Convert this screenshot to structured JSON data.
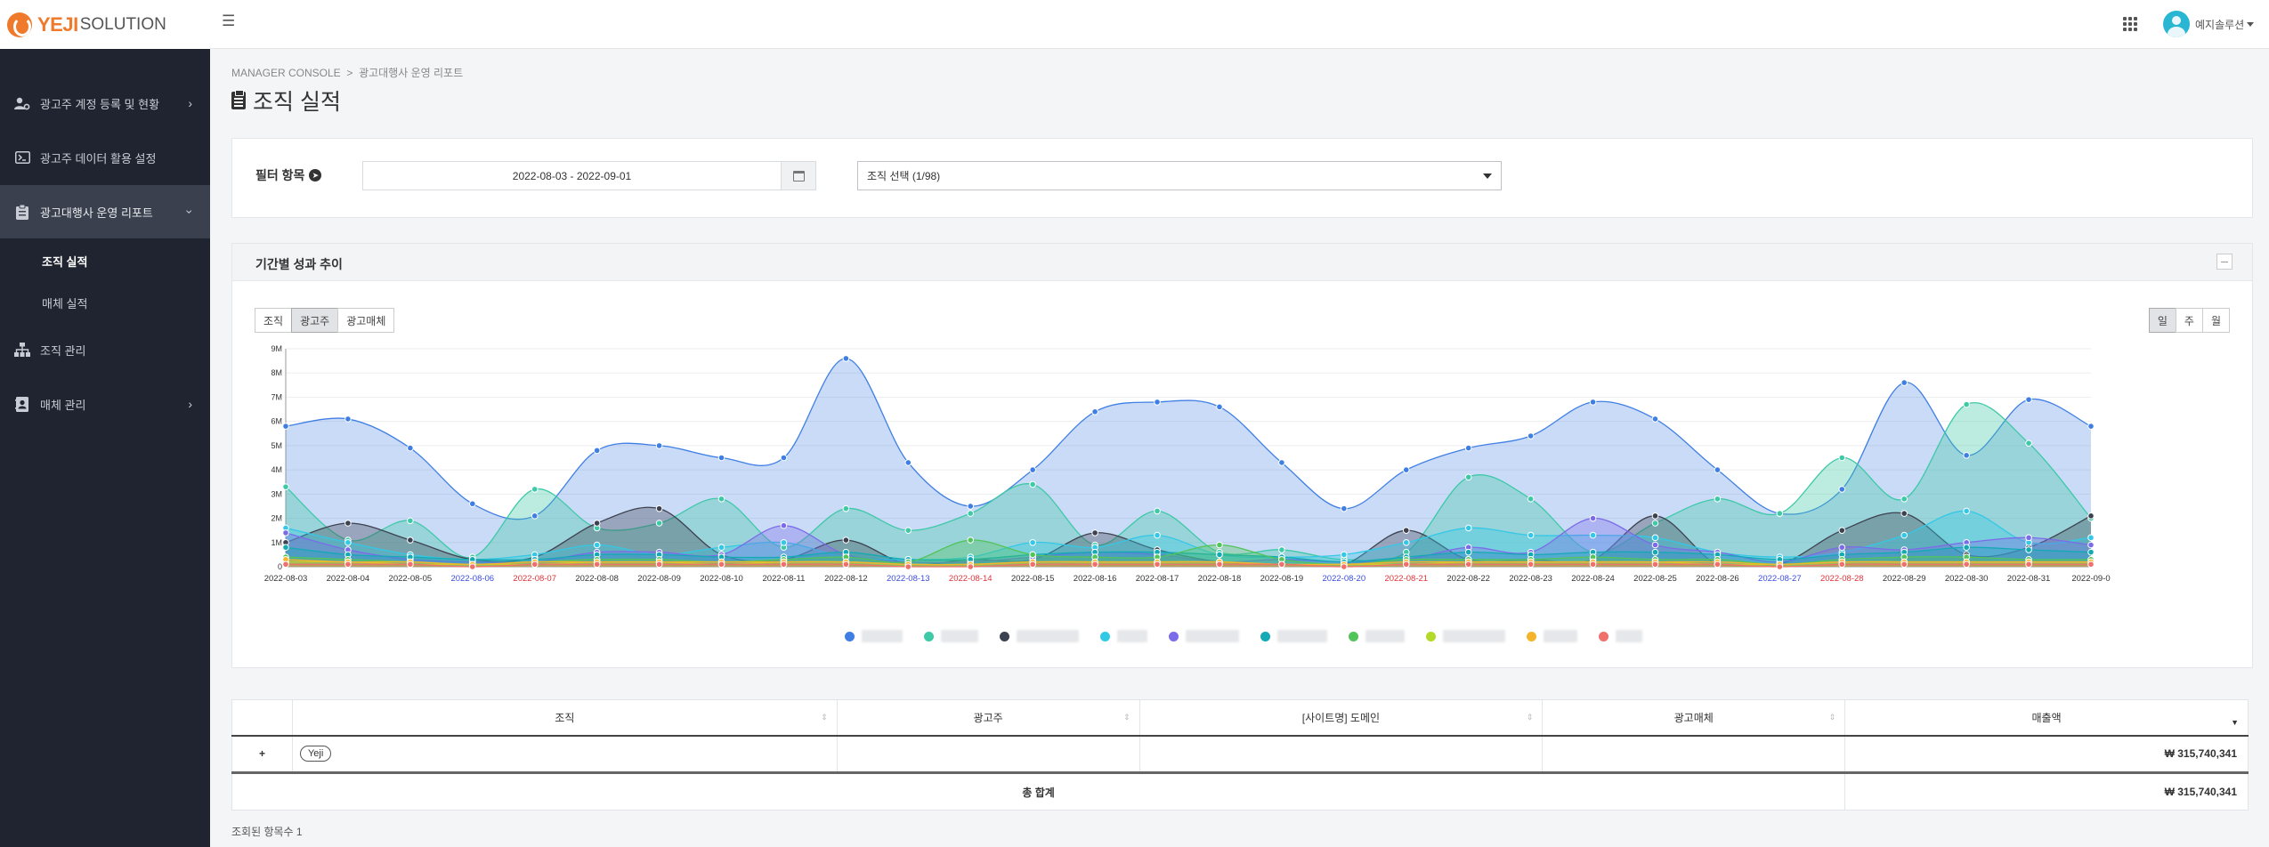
{
  "brand": {
    "name_bold": "YEJI",
    "name_light": "SOLUTION",
    "color": "#f07a2c"
  },
  "header": {
    "user_name": "예지솔루션"
  },
  "sidebar": {
    "items": [
      {
        "label": "광고주 계정 등록 및 현황",
        "icon": "user-gear-icon"
      },
      {
        "label": "광고주 데이터 활용 설정",
        "icon": "terminal-icon"
      },
      {
        "label": "광고대행사 운영 리포트",
        "icon": "clipboard-icon"
      },
      {
        "label": "조직 관리",
        "icon": "org-chart-icon"
      },
      {
        "label": "매체 관리",
        "icon": "address-book-icon"
      }
    ],
    "subitems": [
      {
        "label": "조직 실적"
      },
      {
        "label": "매체 실적"
      }
    ]
  },
  "breadcrumb": {
    "root": "MANAGER CONSOLE",
    "sep": ">",
    "current": "광고대행사 운영 리포트"
  },
  "page": {
    "title": "조직 실적"
  },
  "filter": {
    "label": "필터 항목",
    "date_range": "2022-08-03 - 2022-09-01",
    "org_select": "조직 선택 (1/98)"
  },
  "trend": {
    "title": "기간별 성과 추이",
    "group_buttons": [
      "조직",
      "광고주",
      "광고매체"
    ],
    "group_selected": "광고주",
    "period_buttons": [
      "일",
      "주",
      "월"
    ],
    "period_selected": "일"
  },
  "chart_data": {
    "type": "area",
    "x": [
      "2022-08-03",
      "2022-08-04",
      "2022-08-05",
      "2022-08-06",
      "2022-08-07",
      "2022-08-08",
      "2022-08-09",
      "2022-08-10",
      "2022-08-11",
      "2022-08-12",
      "2022-08-13",
      "2022-08-14",
      "2022-08-15",
      "2022-08-16",
      "2022-08-17",
      "2022-08-18",
      "2022-08-19",
      "2022-08-20",
      "2022-08-21",
      "2022-08-22",
      "2022-08-23",
      "2022-08-24",
      "2022-08-25",
      "2022-08-26",
      "2022-08-27",
      "2022-08-28",
      "2022-08-29",
      "2022-08-30",
      "2022-08-31",
      "2022-09-0"
    ],
    "x_label_colors": {
      "blue": [
        "2022-08-06",
        "2022-08-13",
        "2022-08-20",
        "2022-08-27"
      ],
      "red": [
        "2022-08-07",
        "2022-08-14",
        "2022-08-21",
        "2022-08-28"
      ]
    },
    "y_ticks": [
      "0",
      "1M",
      "2M",
      "3M",
      "4M",
      "5M",
      "6M",
      "7M",
      "8M",
      "9M"
    ],
    "ylim": [
      0,
      9000000
    ],
    "grid": true,
    "legend_position": "bottom",
    "series": [
      {
        "color": "#3f7fe4",
        "values": [
          5.8,
          6.1,
          4.9,
          2.6,
          2.1,
          4.8,
          5.0,
          4.5,
          4.5,
          8.6,
          4.3,
          2.5,
          4.0,
          6.4,
          6.8,
          6.6,
          4.3,
          2.4,
          4.0,
          4.9,
          5.4,
          6.8,
          6.1,
          4.0,
          2.2,
          3.2,
          7.6,
          4.6,
          6.9,
          5.8
        ]
      },
      {
        "color": "#3ec9a7",
        "values": [
          3.3,
          1.1,
          1.9,
          0.4,
          3.2,
          1.6,
          1.8,
          2.8,
          0.8,
          2.4,
          1.5,
          2.2,
          3.4,
          0.9,
          2.3,
          0.6,
          0.7,
          0.3,
          0.6,
          3.7,
          2.8,
          0.6,
          1.8,
          2.8,
          2.2,
          4.5,
          2.8,
          6.7,
          5.1,
          2.0
        ]
      },
      {
        "color": "#3d4250",
        "values": [
          1.0,
          1.8,
          1.1,
          0.3,
          0.4,
          1.8,
          2.4,
          0.5,
          0.3,
          1.1,
          0.1,
          0.3,
          0.3,
          1.4,
          0.7,
          0.2,
          0.1,
          0.1,
          1.5,
          0.3,
          0.3,
          0.3,
          2.1,
          0.1,
          0.1,
          1.5,
          2.2,
          0.5,
          0.8,
          2.1
        ]
      },
      {
        "color": "#33c8e6",
        "values": [
          1.6,
          1.0,
          0.5,
          0.3,
          0.5,
          0.9,
          0.5,
          0.8,
          1.0,
          0.4,
          0.3,
          0.4,
          1.0,
          0.8,
          1.3,
          0.5,
          0.4,
          0.5,
          1.0,
          1.6,
          1.3,
          1.3,
          1.2,
          0.6,
          0.4,
          0.6,
          1.3,
          2.3,
          1.0,
          1.2
        ]
      },
      {
        "color": "#7b6be8",
        "values": [
          1.4,
          0.7,
          0.3,
          0.2,
          0.2,
          0.6,
          0.6,
          0.5,
          1.7,
          0.5,
          0.2,
          0.2,
          0.4,
          0.6,
          0.5,
          0.2,
          0.3,
          0.2,
          0.3,
          0.8,
          0.6,
          2.0,
          0.9,
          0.6,
          0.2,
          0.8,
          0.7,
          1.0,
          1.2,
          0.9
        ]
      },
      {
        "color": "#14aab5",
        "values": [
          0.8,
          0.5,
          0.4,
          0.3,
          0.3,
          0.5,
          0.5,
          0.4,
          0.4,
          0.6,
          0.3,
          0.3,
          0.5,
          0.6,
          0.6,
          0.5,
          0.4,
          0.2,
          0.4,
          0.6,
          0.5,
          0.6,
          0.6,
          0.5,
          0.3,
          0.5,
          0.6,
          0.8,
          0.7,
          0.6
        ]
      },
      {
        "color": "#52c45a",
        "values": [
          0.4,
          0.3,
          0.2,
          0.1,
          0.2,
          0.3,
          0.3,
          0.2,
          0.3,
          0.4,
          0.2,
          1.1,
          0.5,
          0.4,
          0.4,
          0.9,
          0.3,
          0.1,
          0.3,
          0.3,
          0.3,
          0.4,
          0.3,
          0.3,
          0.1,
          0.3,
          0.4,
          0.4,
          0.3,
          0.3
        ]
      },
      {
        "color": "#b3d92a",
        "values": [
          0.2,
          0.2,
          0.1,
          0.1,
          0.1,
          0.2,
          0.2,
          0.1,
          0.2,
          0.2,
          0.1,
          0.1,
          0.2,
          0.2,
          0.2,
          0.2,
          0.1,
          0.1,
          0.1,
          0.2,
          0.2,
          0.2,
          0.2,
          0.1,
          0.1,
          0.2,
          0.2,
          0.2,
          0.2,
          0.2
        ]
      },
      {
        "color": "#f4b52c",
        "values": [
          0.3,
          0.2,
          0.2,
          0.1,
          0.2,
          0.2,
          0.2,
          0.2,
          0.2,
          0.2,
          0.1,
          0.1,
          0.2,
          0.2,
          0.2,
          0.2,
          0.1,
          0.1,
          0.2,
          0.2,
          0.2,
          0.2,
          0.2,
          0.2,
          0.1,
          0.2,
          0.2,
          0.2,
          0.2,
          0.2
        ]
      },
      {
        "color": "#f0706b",
        "values": [
          0.1,
          0.1,
          0.1,
          0.0,
          0.1,
          0.1,
          0.1,
          0.1,
          0.1,
          0.1,
          0.0,
          0.0,
          0.1,
          0.1,
          0.1,
          0.1,
          0.1,
          0.0,
          0.1,
          0.1,
          0.1,
          0.1,
          0.1,
          0.1,
          0.0,
          0.1,
          0.1,
          0.1,
          0.1,
          0.1
        ]
      }
    ],
    "legend_blur_widths": [
      46,
      42,
      70,
      34,
      60,
      56,
      44,
      70,
      38,
      30
    ]
  },
  "table": {
    "headers": [
      "조직",
      "광고주",
      "[사이트명] 도메인",
      "광고매체",
      "매출액"
    ],
    "row": {
      "org": "Yeji",
      "advertiser": "",
      "domain": "",
      "media": "",
      "revenue": "₩ 315,740,341"
    },
    "total_label": "총 합계",
    "total_value": "₩ 315,740,341"
  },
  "footer": {
    "count_label": "조회된 항목수",
    "count_value": "1"
  }
}
